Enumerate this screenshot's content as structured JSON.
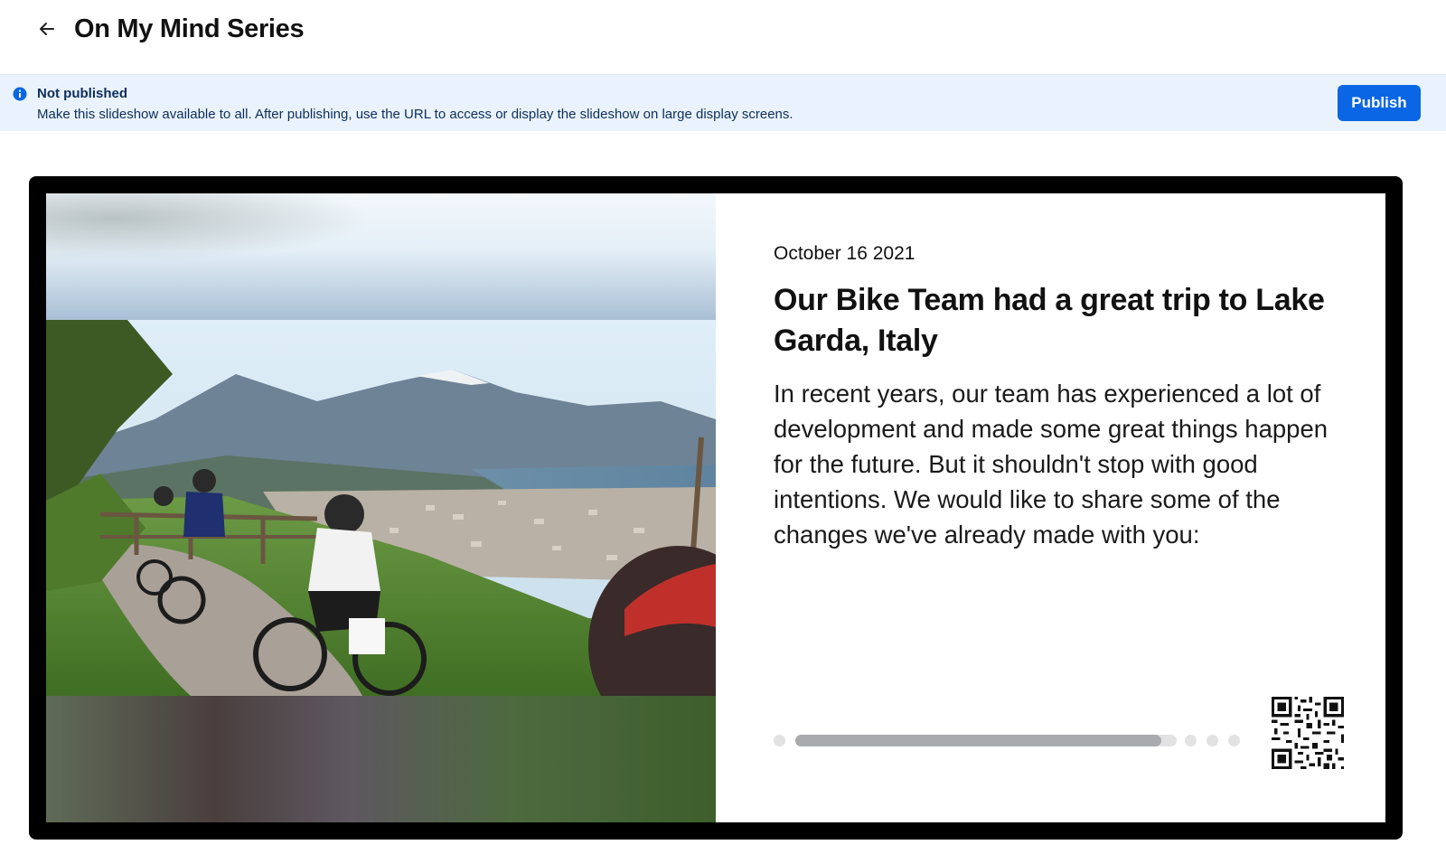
{
  "header": {
    "title": "On My Mind Series"
  },
  "banner": {
    "title": "Not published",
    "text": "Make this slideshow available to all. After publishing, use the URL to access or display the slideshow on large display screens.",
    "publish_label": "Publish",
    "accent_color": "#0a66e4",
    "background_color": "#eaf3fd"
  },
  "slide": {
    "date": "October 16 2021",
    "title": "Our Bike Team had a great trip to Lake Garda, Italy",
    "body": "In recent years, our team has experienced a lot of development and made some great things happen for the future. But it shouldn't stop with good intentions. We would like to share some of the changes we've already made with you:",
    "progress": {
      "current_slide": 2,
      "total_slides": 5,
      "current_fraction": 0.96
    }
  },
  "icons": {
    "back": "arrow-left-icon",
    "info": "info-circle-icon",
    "qr": "qr-code-icon"
  }
}
